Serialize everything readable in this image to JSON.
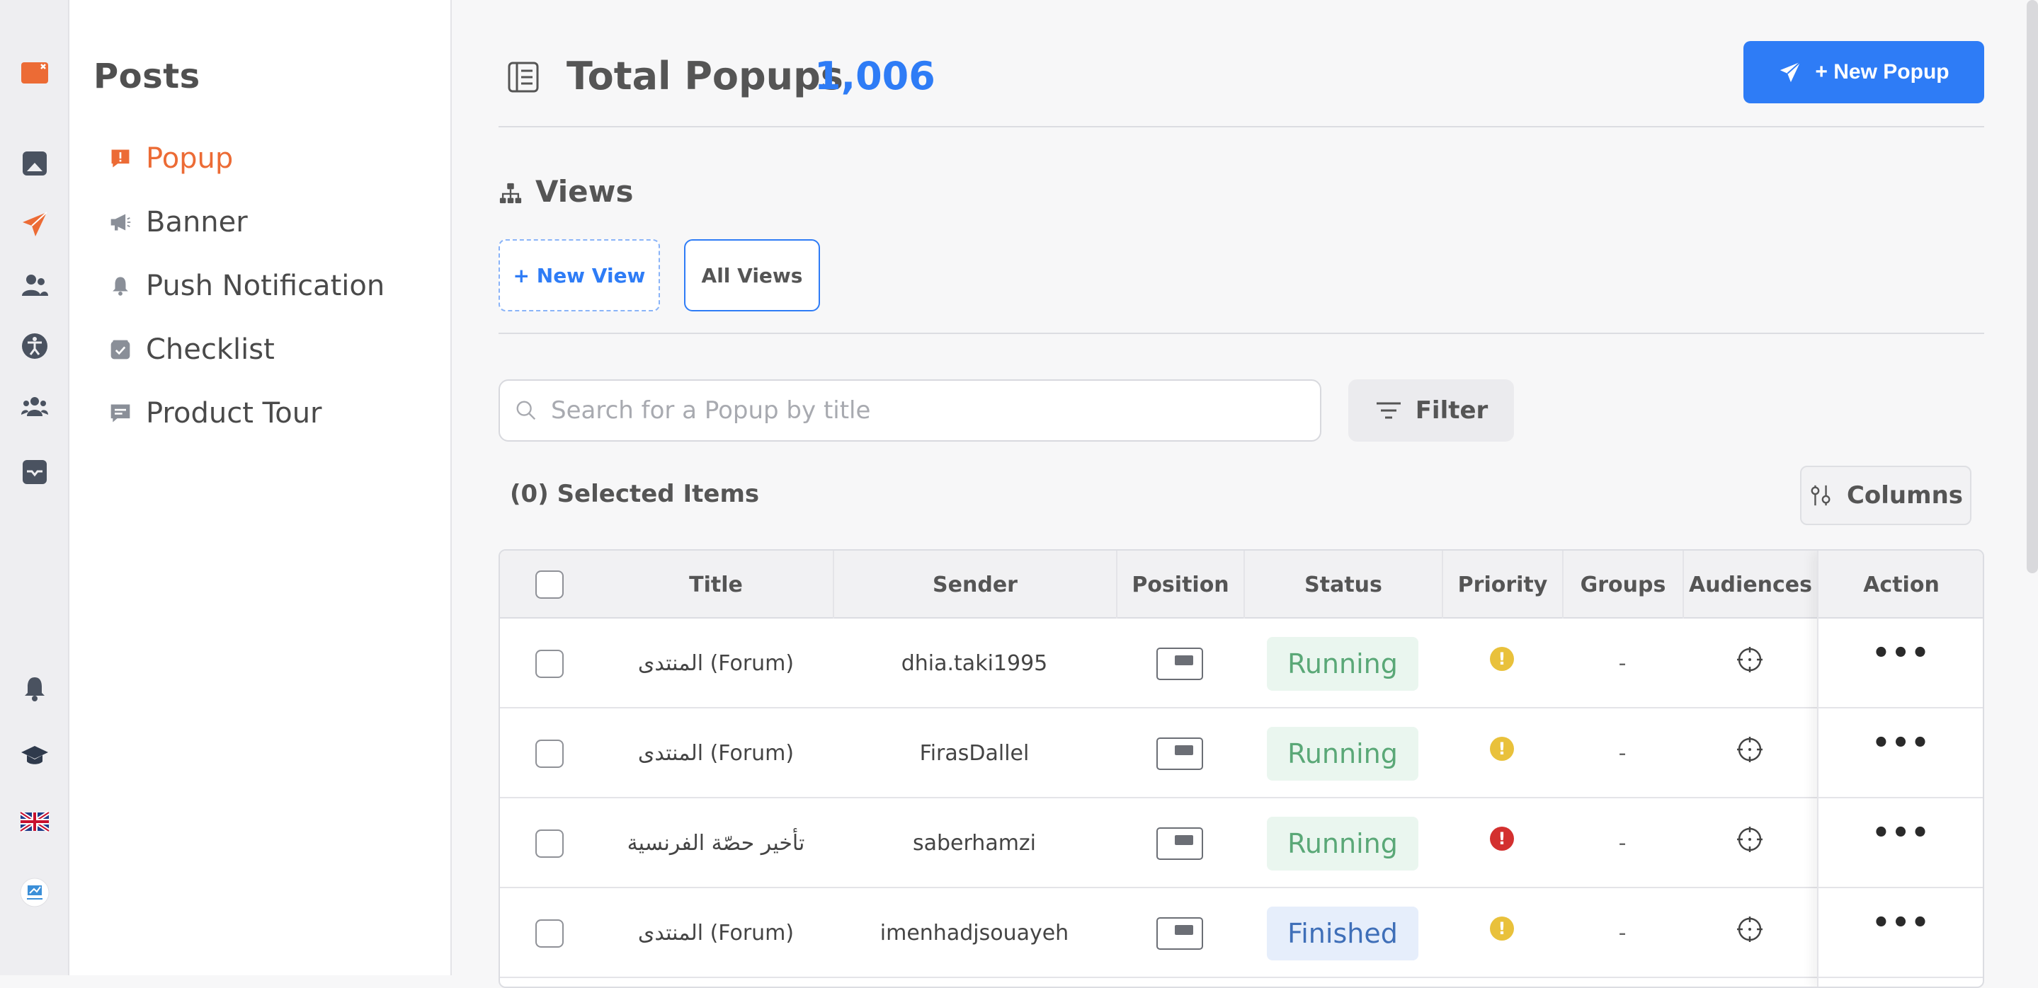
{
  "rail": {
    "icons": [
      "logo-icon",
      "mobile-icon",
      "send-icon",
      "users-icon",
      "accessibility-icon",
      "group-icon",
      "inbox-icon",
      "bell-icon",
      "graduation-cap-icon",
      "uk-flag-icon",
      "academy-avatar-icon"
    ]
  },
  "sidebar": {
    "title": "Posts",
    "items": [
      {
        "label": "Popup",
        "icon": "popup-alert-icon",
        "active": true
      },
      {
        "label": "Banner",
        "icon": "megaphone-icon",
        "active": false
      },
      {
        "label": "Push Notification",
        "icon": "bell-icon",
        "active": false
      },
      {
        "label": "Checklist",
        "icon": "checklist-icon",
        "active": false
      },
      {
        "label": "Product Tour",
        "icon": "chat-icon",
        "active": false
      }
    ]
  },
  "header": {
    "title": "Total Popups",
    "count": "1,006",
    "new_button": "+ New Popup"
  },
  "views": {
    "title": "Views",
    "new_view": "+ New View",
    "all_views": "All Views"
  },
  "search": {
    "placeholder": "Search for a Popup by title",
    "filter_label": "Filter"
  },
  "selection": {
    "text": "(0) Selected Items",
    "columns_label": "Columns"
  },
  "table": {
    "headers": {
      "title": "Title",
      "sender": "Sender",
      "position": "Position",
      "status": "Status",
      "priority": "Priority",
      "groups": "Groups",
      "audiences": "Audiences",
      "action": "Action"
    },
    "rows": [
      {
        "title": "المنتدى (Forum)",
        "sender": "dhia.taki1995",
        "status": "Running",
        "priority": "medium",
        "groups": "-"
      },
      {
        "title": "المنتدى (Forum)",
        "sender": "FirasDallel",
        "status": "Running",
        "priority": "medium",
        "groups": "-"
      },
      {
        "title": "تأخير حصّة الفرنسية",
        "sender": "saberhamzi",
        "status": "Running",
        "priority": "high",
        "groups": "-"
      },
      {
        "title": "المنتدى (Forum)",
        "sender": "imenhadjsouayeh",
        "status": "Finished",
        "priority": "medium",
        "groups": "-"
      }
    ]
  },
  "colors": {
    "accent_orange": "#ec6b35",
    "primary_blue": "#2e7cf6",
    "priority_medium": "#e9c13b",
    "priority_high": "#d3302f"
  }
}
